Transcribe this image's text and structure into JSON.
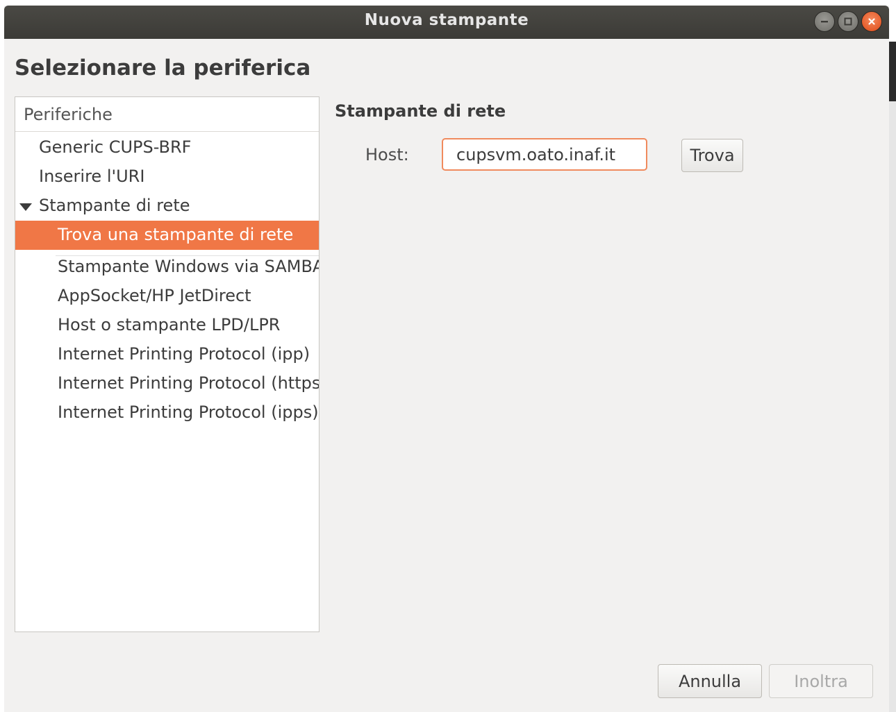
{
  "window": {
    "title": "Nuova stampante"
  },
  "dialog": {
    "heading": "Selezionare la periferica"
  },
  "devices": {
    "header": "Periferiche",
    "items": [
      {
        "label": "Generic CUPS-BRF",
        "level": 0
      },
      {
        "label": "Inserire l'URI",
        "level": 0
      },
      {
        "label": "Stampante di rete",
        "level": 0,
        "expanded": true
      },
      {
        "label": "Trova una stampante di rete",
        "level": 1,
        "selected": true
      },
      {
        "label": "Stampante Windows via SAMBA",
        "level": 1
      },
      {
        "label": "AppSocket/HP JetDirect",
        "level": 1
      },
      {
        "label": "Host o stampante LPD/LPR",
        "level": 1
      },
      {
        "label": "Internet Printing Protocol (ipp)",
        "level": 1
      },
      {
        "label": "Internet Printing Protocol (https)",
        "level": 1
      },
      {
        "label": "Internet Printing Protocol (ipps)",
        "level": 1
      }
    ]
  },
  "network": {
    "section_title": "Stampante di rete",
    "host_label": "Host:",
    "host_value": "cupsvm.oato.inaf.it",
    "find_button": "Trova"
  },
  "footer": {
    "cancel_label": "Annulla",
    "forward_label": "Inoltra"
  },
  "colors": {
    "accent": "#f07746",
    "titlebar": "#3c3b37",
    "close_button": "#df4a16"
  },
  "icons": [
    "minimize-icon",
    "maximize-icon",
    "close-icon",
    "expander-triangle-icon"
  ]
}
